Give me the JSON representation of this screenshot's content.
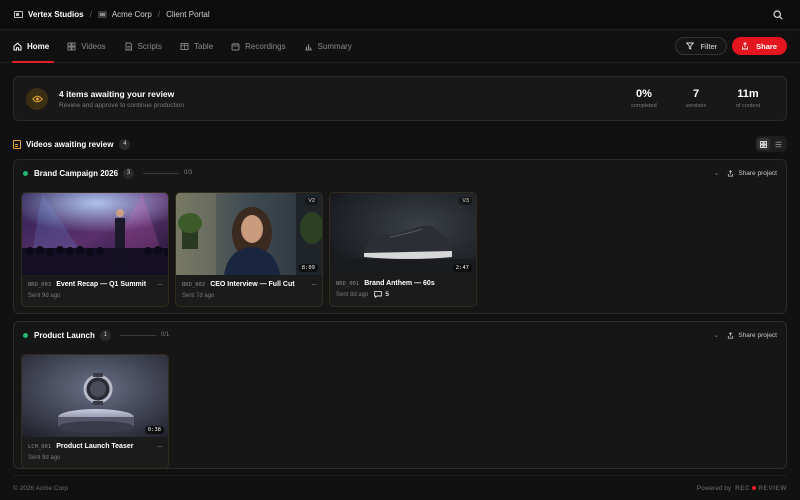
{
  "breadcrumb": {
    "studio": "Vertex Studios",
    "org": "Acme Corp",
    "portal": "Client Portal",
    "separator": "/"
  },
  "nav": {
    "tabs": [
      {
        "label": "Home",
        "icon": "home-icon",
        "active": true
      },
      {
        "label": "Videos",
        "icon": "grid-icon",
        "active": false
      },
      {
        "label": "Scripts",
        "icon": "document-icon",
        "active": false
      },
      {
        "label": "Table",
        "icon": "table-icon",
        "active": false
      },
      {
        "label": "Recordings",
        "icon": "calendar-icon",
        "active": false
      },
      {
        "label": "Summary",
        "icon": "bar-chart-icon",
        "active": false
      }
    ],
    "filter_label": "Filter",
    "share_label": "Share"
  },
  "banner": {
    "title": "4 items awaiting your review",
    "subtitle": "Review and approve to continue production",
    "stats": [
      {
        "value": "0%",
        "label": "completed"
      },
      {
        "value": "7",
        "label": "versions"
      },
      {
        "value": "11m",
        "label": "of content"
      }
    ]
  },
  "section": {
    "title": "Videos awaiting review",
    "count": "4"
  },
  "projects": [
    {
      "name": "Brand Campaign 2026",
      "count": "3",
      "progress": "0/3",
      "share_label": "Share project",
      "videos": [
        {
          "code": "BRD_003",
          "title": "Event Recap — Q1 Summit",
          "sent": "Sent 9d ago",
          "version": "",
          "duration": "",
          "comments": ""
        },
        {
          "code": "BRD_002",
          "title": "CEO Interview — Full Cut",
          "sent": "Sent 7d ago",
          "version": "V2",
          "duration": "8:09",
          "comments": ""
        },
        {
          "code": "BRD_001",
          "title": "Brand Anthem — 60s",
          "sent": "Sent 8d ago",
          "version": "V3",
          "duration": "2:47",
          "comments": "5"
        }
      ]
    },
    {
      "name": "Product Launch",
      "count": "1",
      "progress": "0/1",
      "share_label": "Share project",
      "videos": [
        {
          "code": "LCH_001",
          "title": "Product Launch Teaser",
          "sent": "Sent 9d ago",
          "version": "",
          "duration": "0:38",
          "comments": ""
        }
      ]
    }
  ],
  "footer": {
    "copyright": "© 2026 Acme Corp",
    "powered": "Powered by",
    "brand_left": "REC",
    "brand_right": "REVIEW"
  },
  "colors": {
    "accent": "#e4151f",
    "status_green": "#22b573",
    "warning": "#e6a235"
  }
}
